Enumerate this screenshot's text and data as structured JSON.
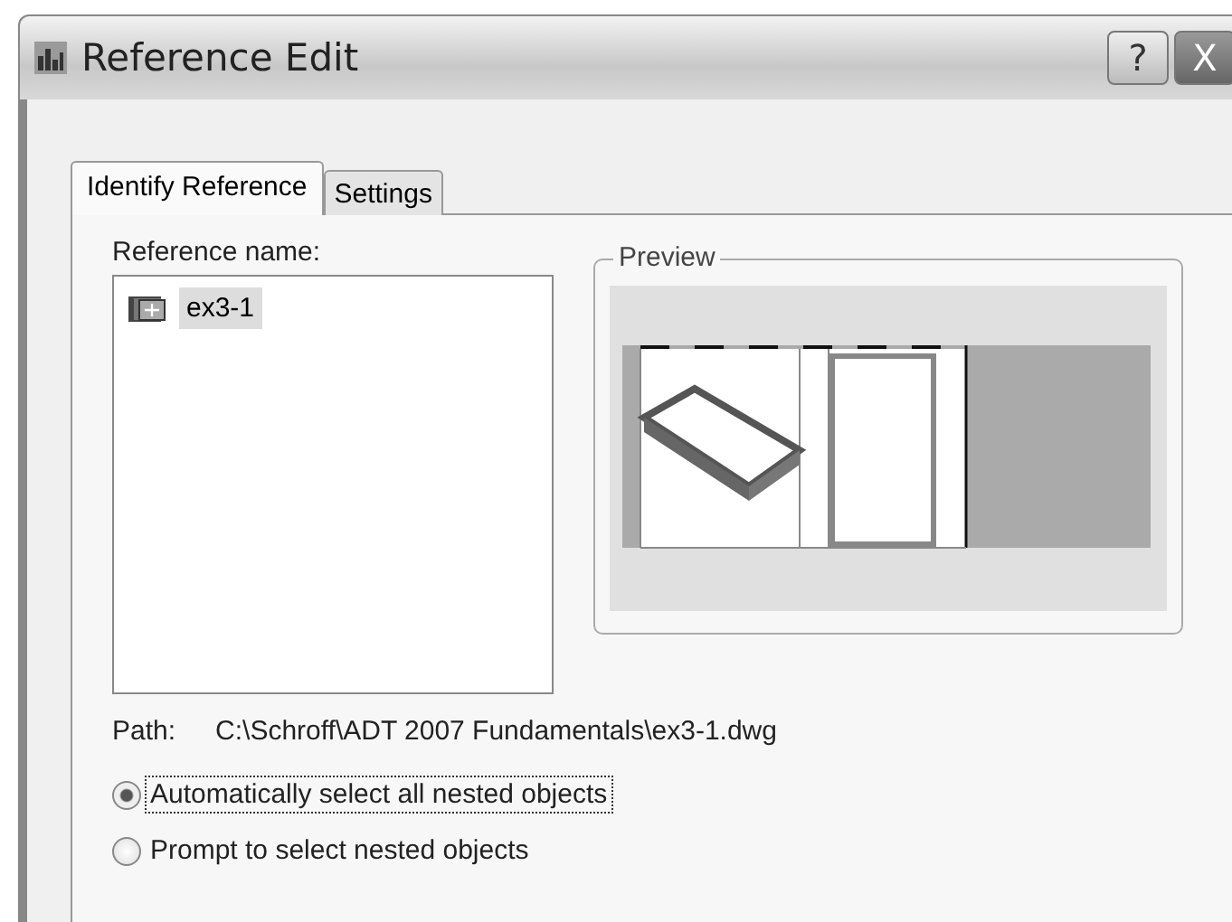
{
  "window": {
    "title": "Reference Edit",
    "buttons": [
      "?",
      "X"
    ]
  },
  "tabs": [
    {
      "label": "Identify Reference",
      "selected": true
    },
    {
      "label": "Settings",
      "selected": false
    }
  ],
  "reference_list": {
    "label": "Reference name:",
    "items": [
      {
        "name": "ex3-1",
        "selected": true
      }
    ]
  },
  "preview": {
    "title": "Preview"
  },
  "path": {
    "label": "Path:",
    "value": "C:\\Schroff\\ADT 2007 Fundamentals\\ex3-1.dwg"
  },
  "options": [
    {
      "label": "Automatically select all nested objects",
      "selected": true
    },
    {
      "label": "Prompt to select nested objects",
      "selected": false
    }
  ]
}
